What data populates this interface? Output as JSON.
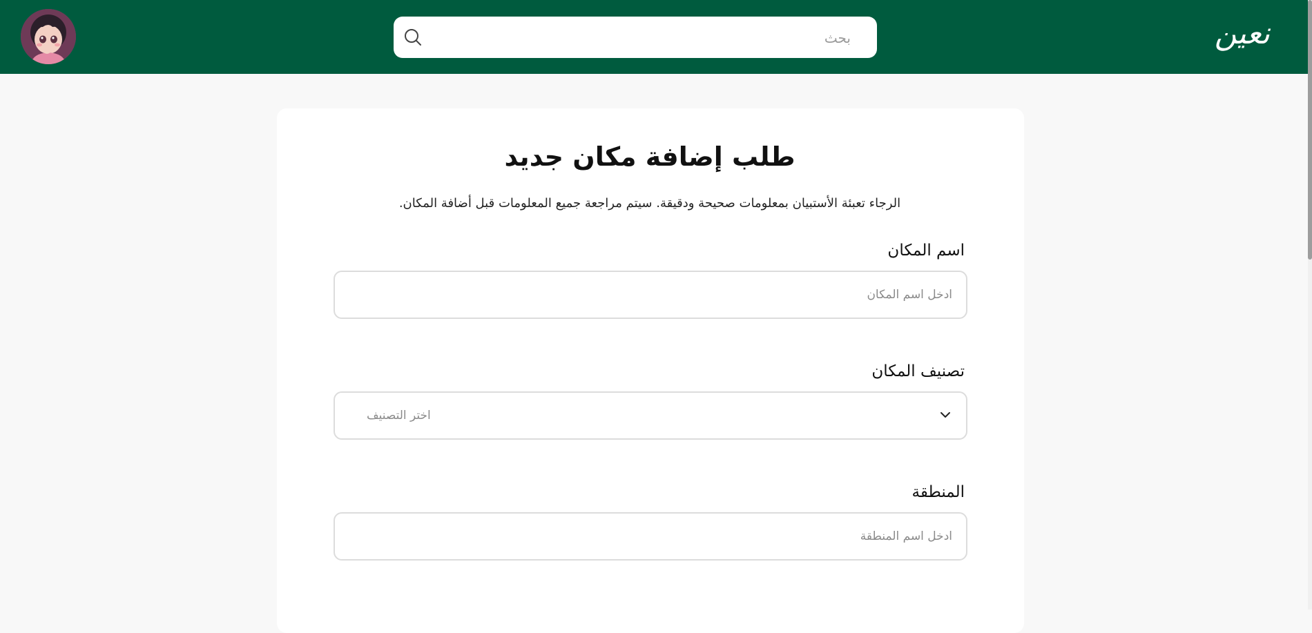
{
  "header": {
    "logo_text": "نعين",
    "search_placeholder": "بحث"
  },
  "form": {
    "title": "طلب إضافة مكان جديد",
    "subtitle": "الرجاء تعبئة الأستبيان بمعلومات صحيحة ودقيقة. سيتم مراجعة جميع المعلومات قبل أضافة المكان.",
    "place_name": {
      "label": "اسم المكان",
      "placeholder": "ادخل اسم المكان"
    },
    "category": {
      "label": "تصنيف المكان",
      "selected": "اختر التصنيف"
    },
    "region": {
      "label": "المنطقة",
      "placeholder": "ادخل اسم المنطقة"
    }
  },
  "colors": {
    "header_bg": "#005b3e",
    "page_bg": "#f8f8f8",
    "card_bg": "#ffffff"
  },
  "icons": {
    "search": "search-icon",
    "chevron": "chevron-down-icon",
    "avatar": "user-avatar"
  }
}
